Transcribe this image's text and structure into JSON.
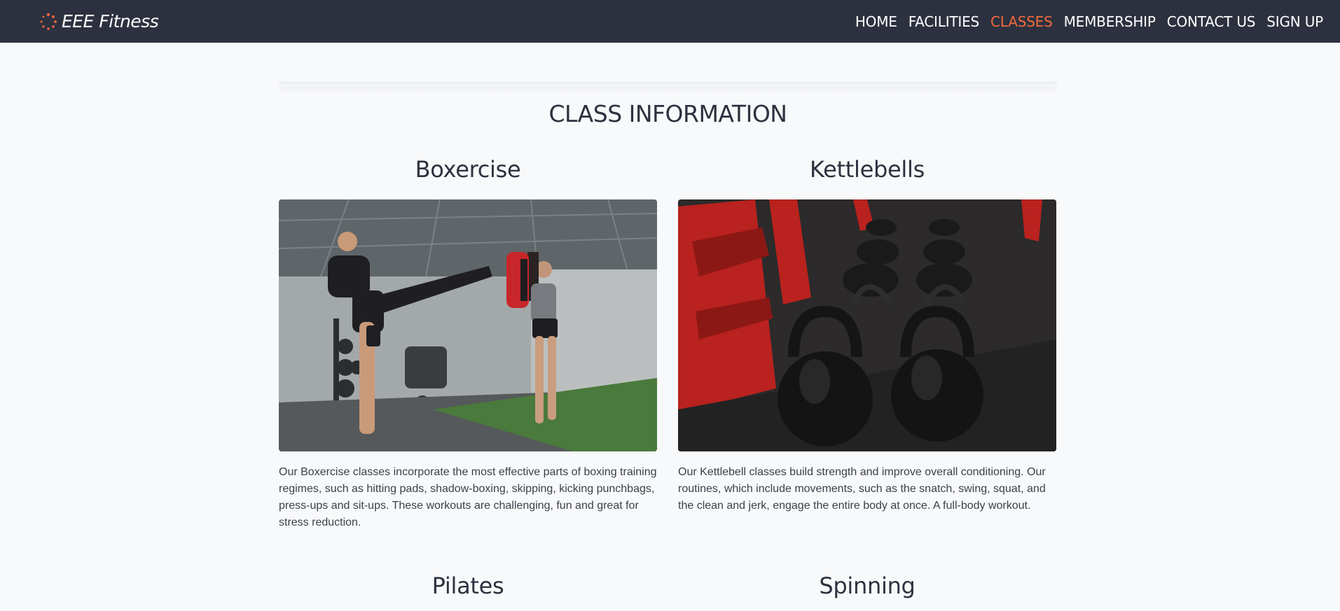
{
  "navbar": {
    "brand": "EEE Fitness",
    "brand_icon": "spinner-dots-icon",
    "accent_color": "#f26a3a",
    "links": [
      {
        "label": "HOME",
        "active": false
      },
      {
        "label": "FACILITIES",
        "active": false
      },
      {
        "label": "CLASSES",
        "active": true
      },
      {
        "label": "MEMBERSHIP",
        "active": false
      },
      {
        "label": "CONTACT US",
        "active": false
      },
      {
        "label": "SIGN UP",
        "active": false
      }
    ]
  },
  "page": {
    "title": "CLASS INFORMATION",
    "classes": [
      {
        "name": "Boxercise",
        "image": "boxercise-photo",
        "description": "Our Boxercise classes incorporate the most effective parts of boxing training regimes, such as hitting pads, shadow-boxing, skipping, kicking punchbags, press-ups and sit-ups. These workouts are challenging, fun and great for stress reduction."
      },
      {
        "name": "Kettlebells",
        "image": "kettlebells-photo",
        "description": "Our Kettlebell classes build strength and improve overall conditioning. Our routines, which include movements, such as the snatch, swing, squat, and the clean and jerk, engage the entire body at once. A full-body workout."
      },
      {
        "name": "Pilates"
      },
      {
        "name": "Spinning"
      }
    ]
  }
}
